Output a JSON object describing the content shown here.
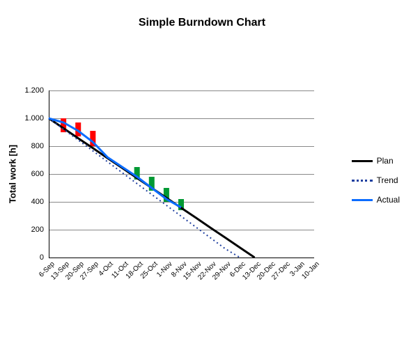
{
  "chart_data": {
    "type": "line",
    "title": "Simple Burndown Chart",
    "ylabel": "Total work [h]",
    "xlabel": "",
    "ylim": [
      0,
      1200
    ],
    "yticks": [
      0,
      200,
      400,
      600,
      800,
      1000,
      1200
    ],
    "ytick_labels": [
      "0",
      "200",
      "400",
      "600",
      "800",
      "1.000",
      "1.200"
    ],
    "categories": [
      "6-Sep",
      "13-Sep",
      "20-Sep",
      "27-Sep",
      "4-Oct",
      "11-Oct",
      "18-Oct",
      "25-Oct",
      "1-Nov",
      "8-Nov",
      "15-Nov",
      "22-Nov",
      "29-Nov",
      "6-Dec",
      "13-Dec",
      "20-Dec",
      "27-Dec",
      "3-Jan",
      "10-Jan"
    ],
    "series": [
      {
        "name": "Plan",
        "color": "#000000",
        "width": 3,
        "style": "solid",
        "values": [
          1000,
          929,
          857,
          786,
          714,
          643,
          571,
          500,
          429,
          357,
          286,
          214,
          143,
          71,
          0,
          null,
          null,
          null,
          null
        ]
      },
      {
        "name": "Trend",
        "color": "#1f3f9f",
        "width": 2,
        "style": "dotted",
        "values": [
          1000,
          922,
          844,
          766,
          688,
          609,
          531,
          453,
          375,
          297,
          219,
          141,
          63,
          0,
          null,
          null,
          null,
          null,
          null
        ]
      },
      {
        "name": "Actual",
        "color": "#0b6cff",
        "width": 3,
        "style": "solid",
        "values": [
          1000,
          970,
          910,
          830,
          720,
          650,
          580,
          500,
          420,
          360,
          null,
          null,
          null,
          null,
          null,
          null,
          null,
          null,
          null
        ]
      }
    ],
    "bars": [
      {
        "x": 1,
        "top": 1000,
        "bottom": 900,
        "color": "#ff0000"
      },
      {
        "x": 2,
        "top": 970,
        "bottom": 870,
        "color": "#ff0000"
      },
      {
        "x": 3,
        "top": 910,
        "bottom": 800,
        "color": "#ff0000"
      },
      {
        "x": 6,
        "top": 650,
        "bottom": 560,
        "color": "#009933"
      },
      {
        "x": 7,
        "top": 580,
        "bottom": 480,
        "color": "#009933"
      },
      {
        "x": 8,
        "top": 500,
        "bottom": 400,
        "color": "#009933"
      },
      {
        "x": 9,
        "top": 420,
        "bottom": 340,
        "color": "#009933"
      }
    ],
    "legend": [
      {
        "label": "Plan",
        "color": "#000000",
        "style": "solid"
      },
      {
        "label": "Trend",
        "color": "#1f3f9f",
        "style": "dotted"
      },
      {
        "label": "Actual",
        "color": "#0b6cff",
        "style": "solid"
      }
    ]
  }
}
